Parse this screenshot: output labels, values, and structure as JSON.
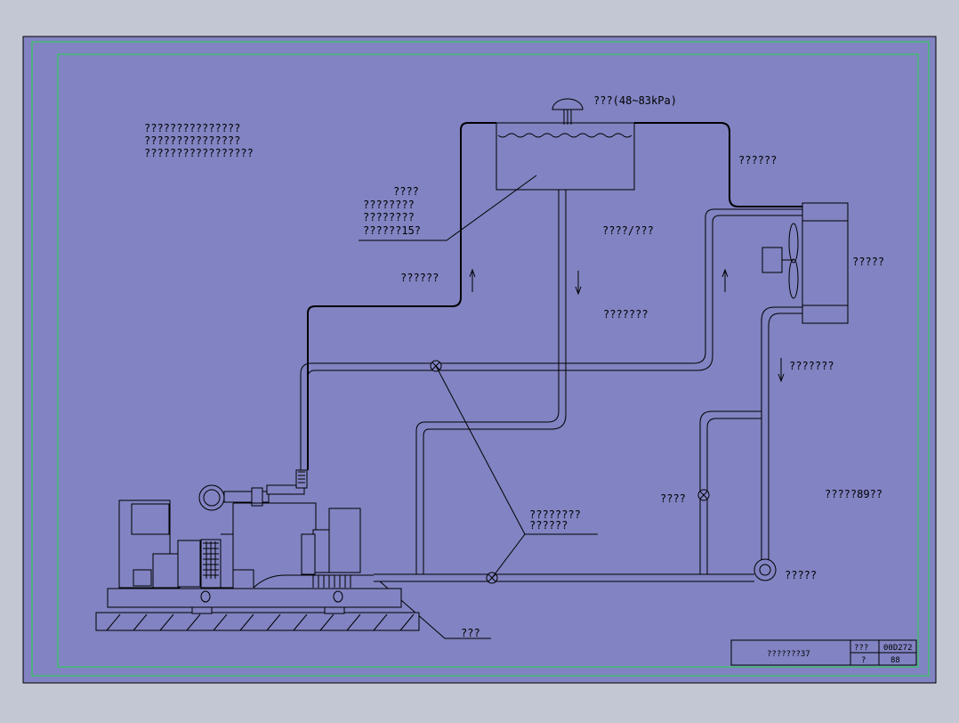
{
  "colors": {
    "canvas_bg": "#c3c6d3",
    "sheet_bg": "#8183c2",
    "border_green": "#22d94a",
    "line": "#000000"
  },
  "labels": {
    "cap": "???(48~83kPa)",
    "top_right_pipe": "??????",
    "expansion_tank": [
      "????",
      "????????",
      "????????",
      "??????15?"
    ],
    "notes": [
      "???????????????",
      "???????????????",
      "?????????????????"
    ],
    "left_pipe": "??????",
    "middle_right_pipe": "????/???",
    "center_pipe": "???????",
    "radiator": "?????",
    "right_pipe": "???????",
    "valve": "????",
    "temp": "?????89??",
    "valves_note": [
      "????????",
      "??????"
    ],
    "pump": "?????",
    "drain": "???"
  },
  "title_block": {
    "name": "???????37",
    "code_label": "???",
    "code_value": "00D272",
    "sheet_label": "?",
    "sheet_value": "88"
  }
}
